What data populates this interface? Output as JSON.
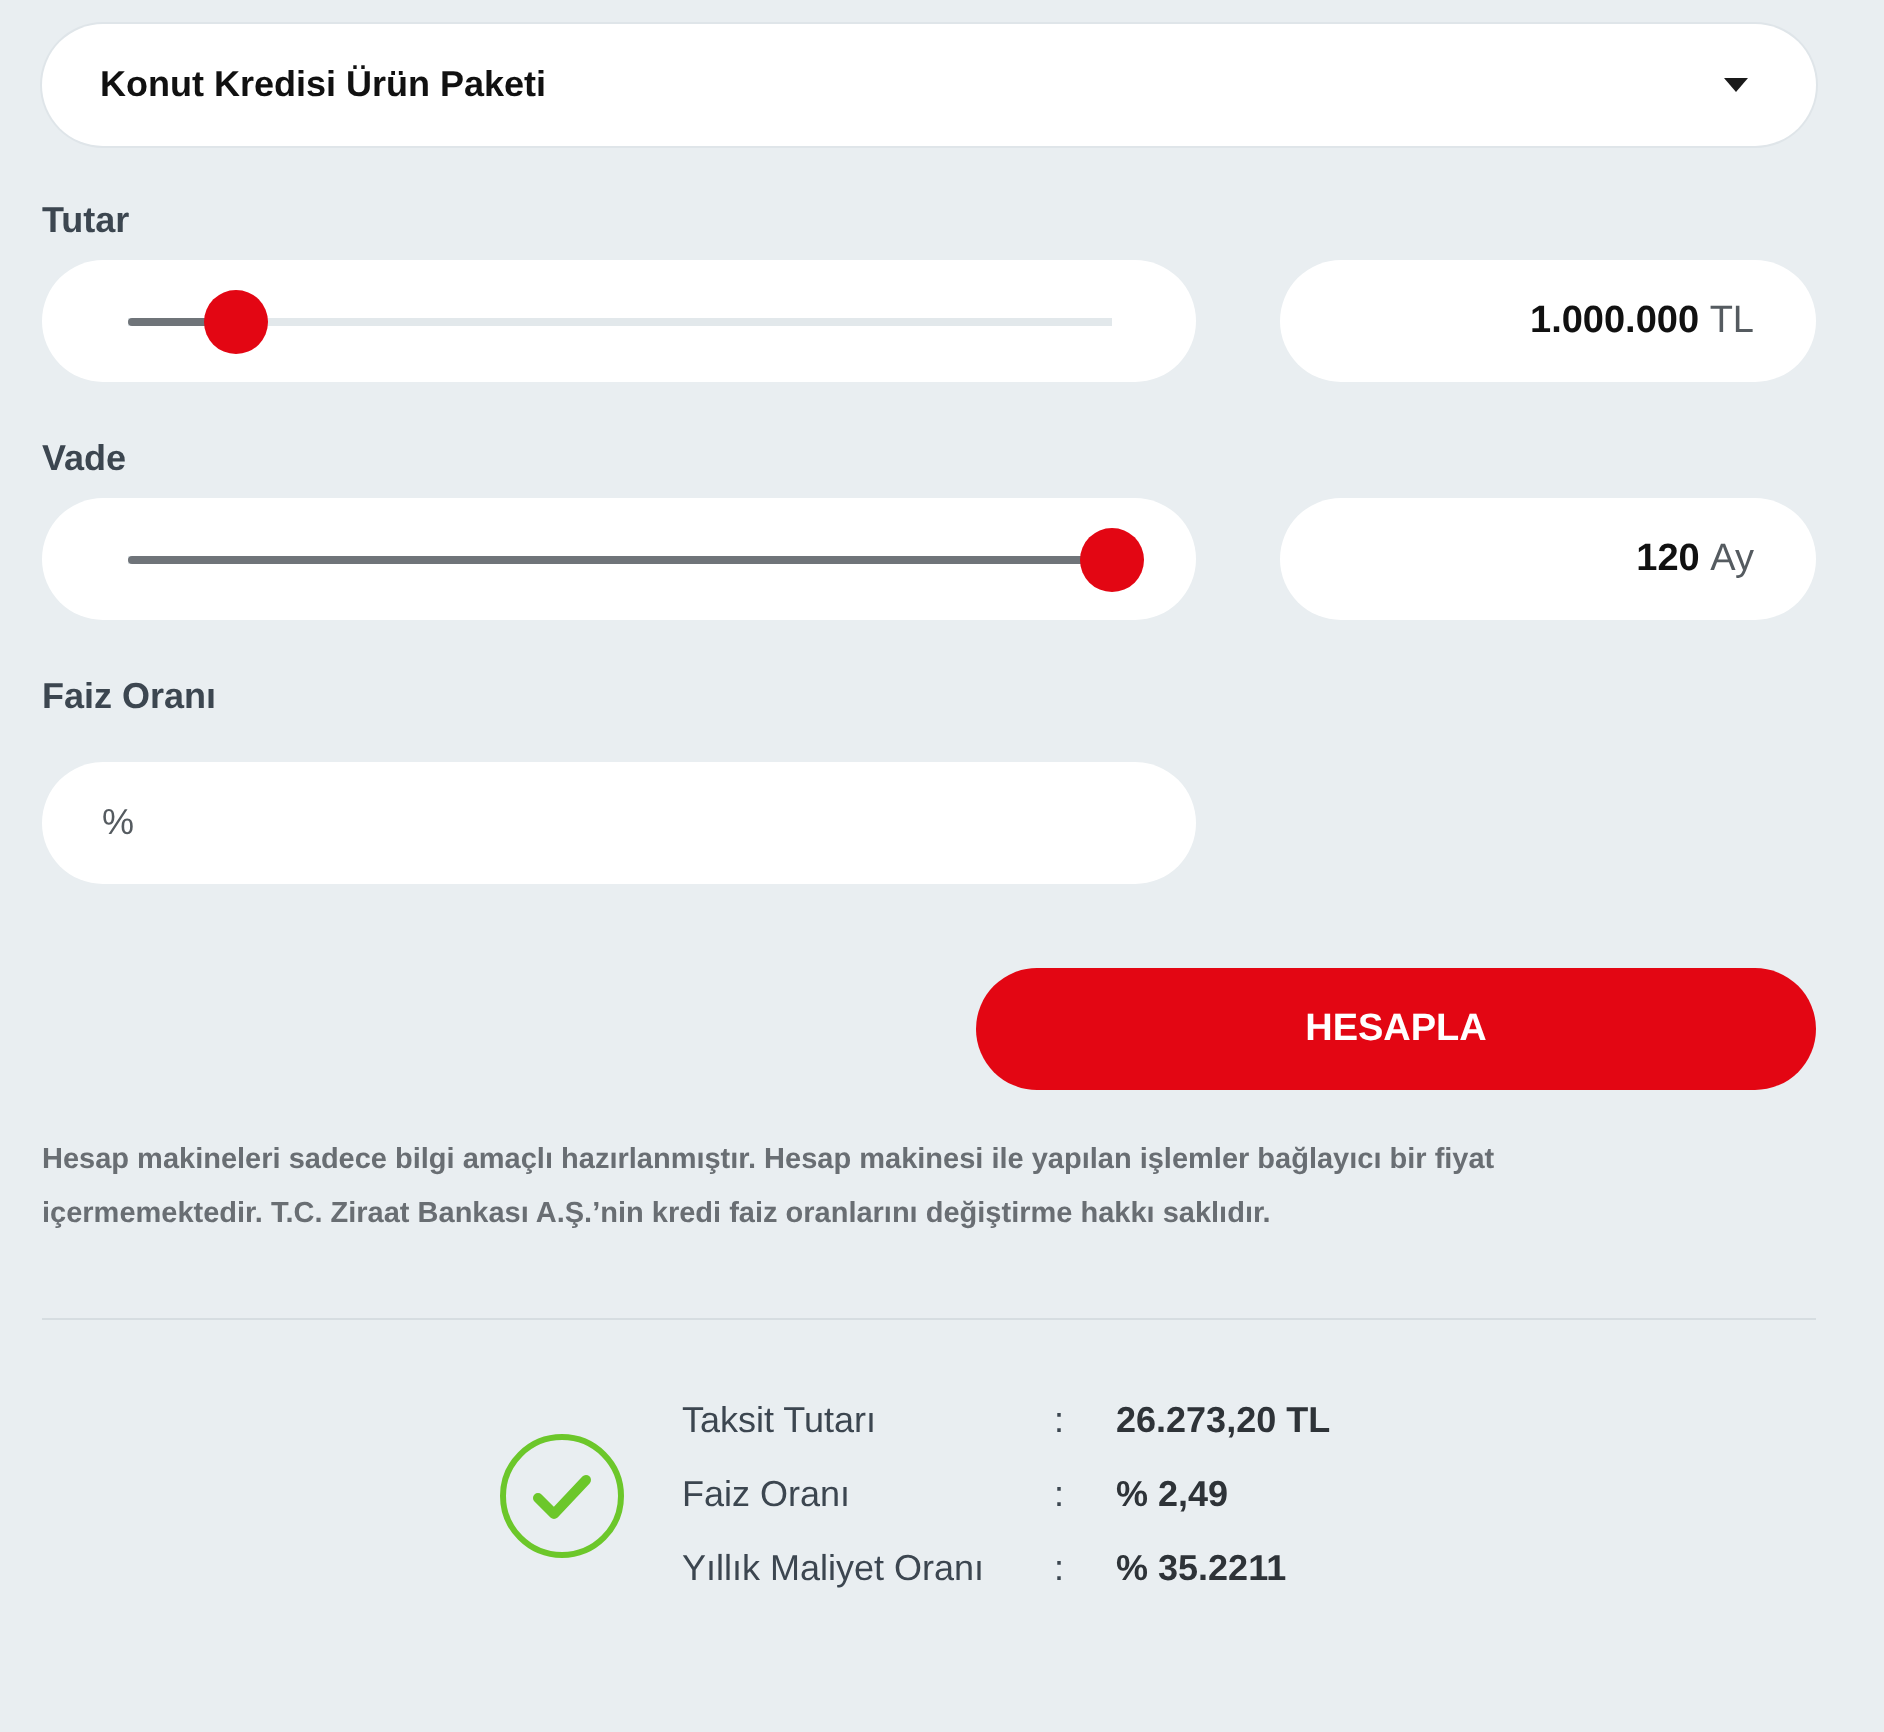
{
  "product_select": {
    "value": "Konut Kredisi Ürün Paketi"
  },
  "fields": [
    {
      "kind": "slider",
      "label": "Tutar",
      "level": 0.11,
      "value": "1.000.000",
      "unit": "TL"
    },
    {
      "kind": "slider",
      "label": "Vade",
      "level": 1,
      "value": "120",
      "unit": "Ay"
    },
    {
      "kind": "input",
      "label": "Faiz Oranı",
      "placeholder": "%"
    }
  ],
  "calculate_button": "HESAPLA",
  "disclaimer": "Hesap makineleri sadece bilgi amaçlı hazırlanmıştır. Hesap makinesi ile yapılan işlemler bağlayıcı bir fiyat içermemektedir. T.C. Ziraat Bankası A.Ş.’nin kredi faiz oranlarını değiştirme hakkı saklıdır.",
  "result": {
    "rows": [
      {
        "label": "Taksit Tutarı",
        "separator": ":",
        "value": "26.273,20 TL"
      },
      {
        "label": "Faiz Oranı",
        "separator": ":",
        "value": "% 2,49"
      },
      {
        "label": "Yıllık Maliyet Oranı",
        "separator": ":",
        "value": "% 35.2211"
      }
    ]
  }
}
